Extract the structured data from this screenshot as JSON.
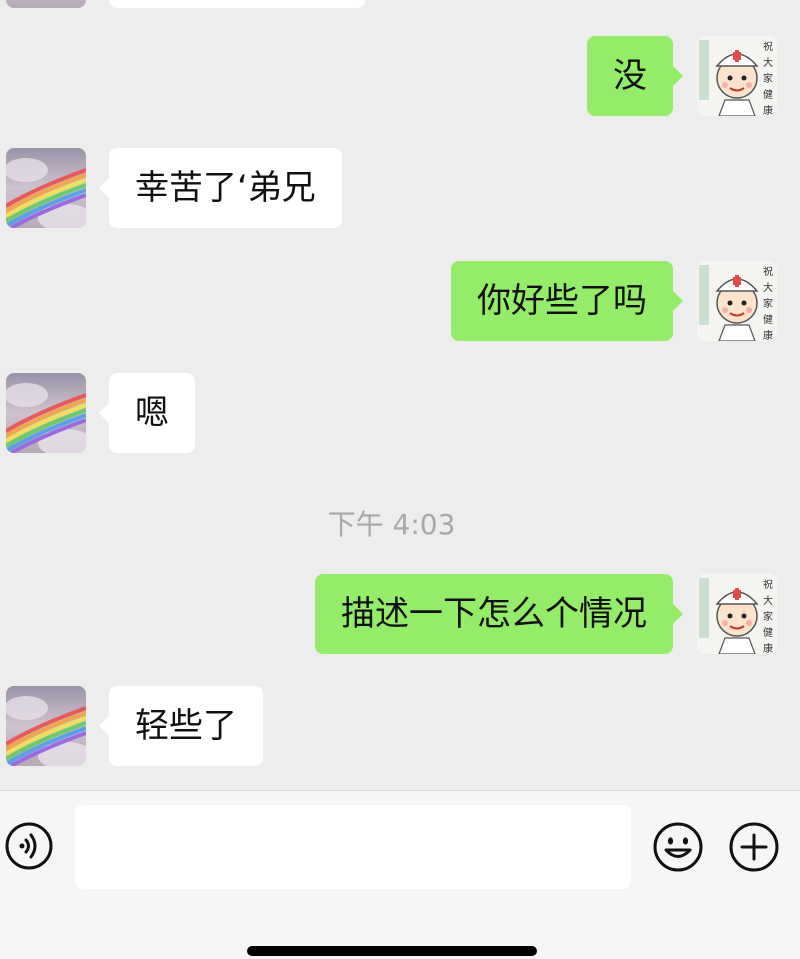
{
  "chat": {
    "messages": [
      {
        "direction": "out",
        "text": "没"
      },
      {
        "direction": "in",
        "text": "幸苦了‘弟兄"
      },
      {
        "direction": "out",
        "text": "你好些了吗"
      },
      {
        "direction": "in",
        "text": "嗯"
      },
      {
        "direction": "out",
        "text": "描述一下怎么个情况"
      },
      {
        "direction": "in",
        "text": "轻些了"
      }
    ],
    "timestamp": "下午 4:03"
  },
  "input_bar": {
    "value": "",
    "placeholder": ""
  },
  "icons": {
    "voice": "voice-icon",
    "emoji": "emoji-icon",
    "plus": "plus-icon"
  },
  "colors": {
    "background": "#EDEDED",
    "outgoing_bubble": "#95EC69",
    "incoming_bubble": "#FFFFFF",
    "timestamp_text": "#A8A8A8"
  }
}
